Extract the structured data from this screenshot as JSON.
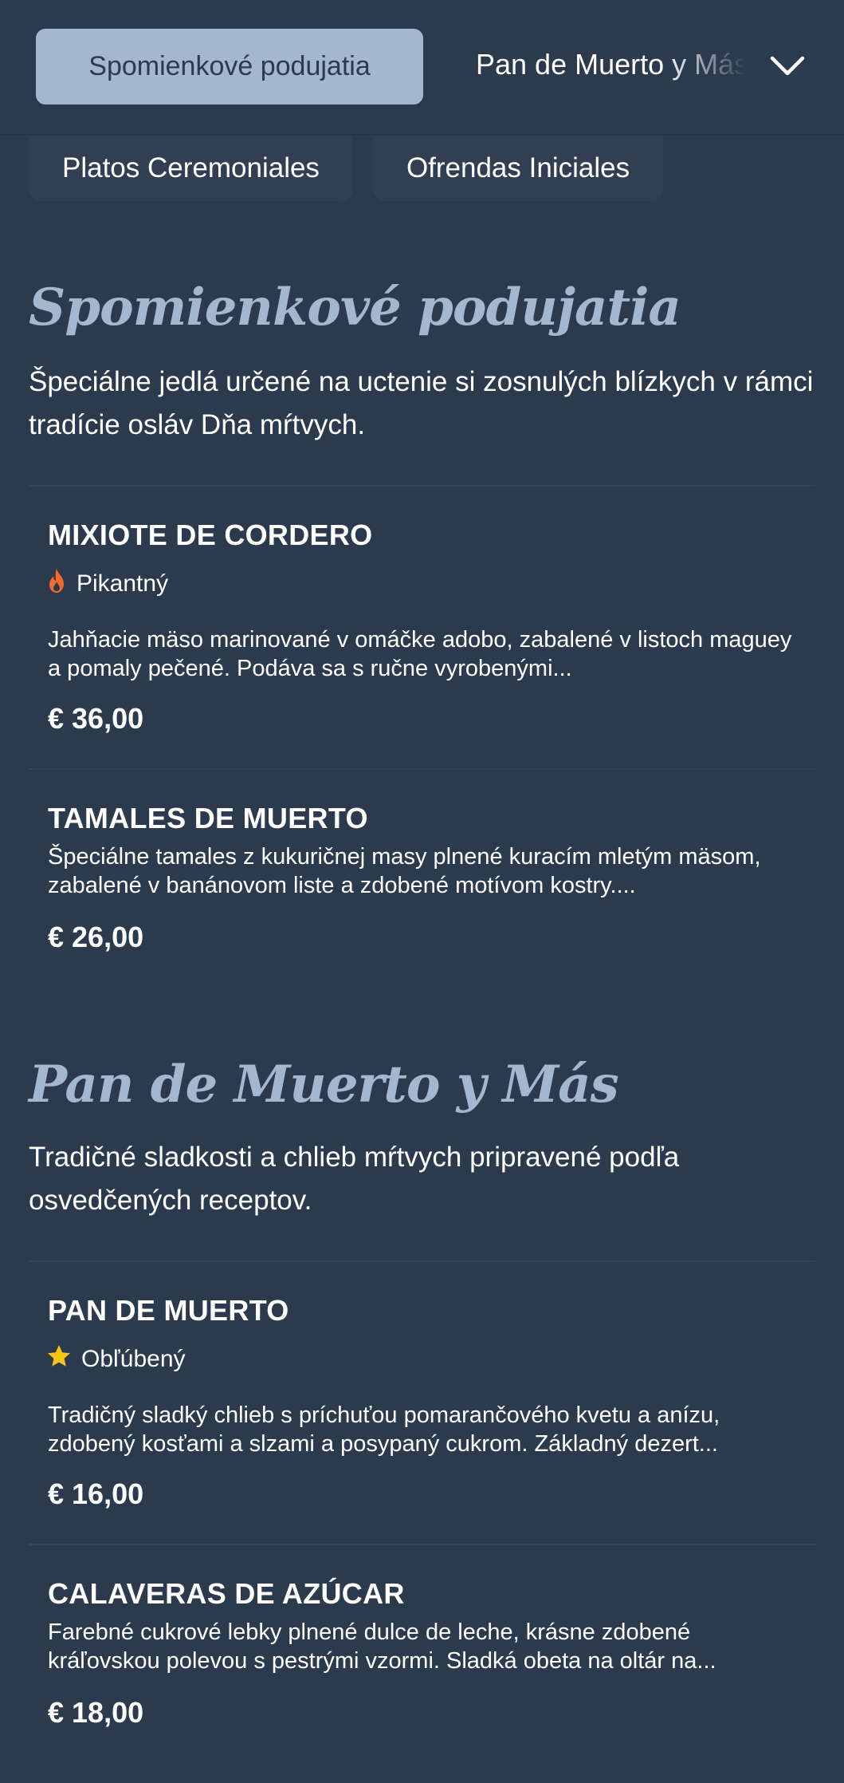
{
  "header": {
    "active_tab": "Spomienkové podujatia",
    "next_tab": "Pan de Muerto y Más",
    "chips": [
      "Platos Ceremoniales",
      "Ofrendas Iniciales"
    ]
  },
  "sections": [
    {
      "title": "Spomienkové podujatia",
      "description": "Špeciálne jedlá určené na uctenie si zosnulých blízkych v rámci tradície osláv Dňa mŕtvych.",
      "items": [
        {
          "name": "MIXIOTE DE CORDERO",
          "badge": "Pikantný",
          "badge_icon": "flame-icon",
          "description": "Jahňacie mäso marinované v omáčke adobo, zabalené v listoch maguey a pomaly pečené. Podáva sa s ručne vyrobenými...",
          "price": "€ 36,00"
        },
        {
          "name": "TAMALES DE MUERTO",
          "description": "Špeciálne tamales z kukuričnej masy plnené kuracím mletým mäsom, zabalené v banánovom liste a zdobené motívom kostry....",
          "price": "€ 26,00"
        }
      ]
    },
    {
      "title": "Pan de Muerto y Más",
      "description": "Tradičné sladkosti a chlieb mŕtvych pripravené podľa osvedčených receptov.",
      "items": [
        {
          "name": "PAN DE MUERTO",
          "badge": "Obľúbený",
          "badge_icon": "star-icon",
          "description": "Tradičný sladký chlieb s príchuťou pomarančového kvetu a anízu, zdobený kosťami a slzami a posypaný cukrom. Základný dezert...",
          "price": "€ 16,00"
        },
        {
          "name": "CALAVERAS DE AZÚCAR",
          "description": "Farebné cukrové lebky plnené dulce de leche, krásne zdobené kráľovskou polevou s pestrými vzormi. Sladká obeta na oltár na...",
          "price": "€ 18,00"
        }
      ]
    }
  ],
  "colors": {
    "background": "#2c3a4d",
    "accent": "#a3b7cf",
    "flame": "#f26a2e",
    "star": "#f5c518"
  }
}
